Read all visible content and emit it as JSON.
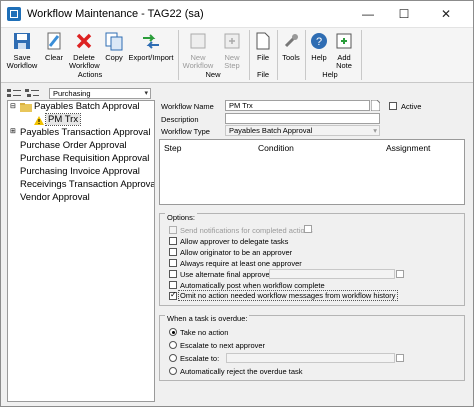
{
  "window": {
    "title": "Workflow Maintenance  -  TAG22 (sa)",
    "minimize": "—",
    "maximize": "☐",
    "close": "✕"
  },
  "ribbon": {
    "save": "Save Workflow",
    "clear": "Clear",
    "delete": "Delete Workflow",
    "copy": "Copy",
    "export_import": "Export/Import",
    "new_workflow": "New Workflow",
    "new_step": "New Step",
    "file": "File",
    "tools": "Tools",
    "help": "Help",
    "add_note": "Add Note",
    "groups": {
      "actions": "Actions",
      "new": "New",
      "file": "File",
      "help": "Help"
    }
  },
  "left": {
    "filter_value": "Purchasing",
    "tree": [
      {
        "label": "Payables Batch Approval",
        "expanded": true
      },
      {
        "label": "PM Trx",
        "child": true,
        "warning": true
      },
      {
        "label": "Payables Transaction Approval"
      },
      {
        "label": "Purchase Order Approval"
      },
      {
        "label": "Purchase Requisition Approval"
      },
      {
        "label": "Purchasing Invoice Approval"
      },
      {
        "label": "Receivings Transaction Approval"
      },
      {
        "label": "Vendor Approval"
      }
    ]
  },
  "form": {
    "workflow_name_label": "Workflow Name",
    "workflow_name": "PM Trx",
    "description_label": "Description",
    "description": "",
    "workflow_type_label": "Workflow Type",
    "workflow_type": "Payables Batch Approval",
    "active_label": "Active"
  },
  "steps_grid": {
    "columns": [
      "Step",
      "Condition",
      "Assignment"
    ]
  },
  "options": {
    "title": "Options:",
    "send_notifications": "Send notifications for completed actions",
    "allow_delegate": "Allow approver to delegate tasks",
    "allow_originator": "Allow originator to be an approver",
    "require_one": "Always require at least one approver",
    "use_alternate": "Use alternate final approver",
    "auto_post": "Automatically post when workflow complete",
    "omit_no_action": "Omit no action needed workflow messages from workflow history"
  },
  "overdue": {
    "title": "When a task is overdue:",
    "take_no_action": "Take no action",
    "escalate_next": "Escalate to next approver",
    "escalate_to": "Escalate to:",
    "auto_reject": "Automatically reject the overdue task"
  },
  "colors": {
    "accent": "#1e6fb8",
    "warning": "#f2c200"
  }
}
